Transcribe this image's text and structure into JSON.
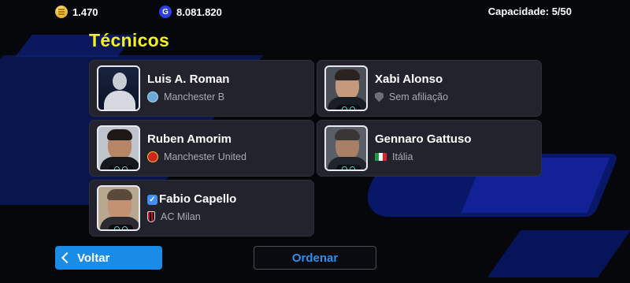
{
  "header": {
    "coins": "1.470",
    "gp": "8.081.820",
    "gp_icon_letter": "G",
    "capacity": "Capacidade: 5/50"
  },
  "page": {
    "title": "Técnicos"
  },
  "coaches": [
    {
      "name": "Luis A. Roman",
      "club": "Manchester B",
      "club_icon": "manchester-city-crest-icon",
      "portrait": "generic-silhouette"
    },
    {
      "name": "Xabi Alonso",
      "club": "Sem afiliação",
      "club_icon": "empty-shield-icon",
      "portrait": "photo"
    },
    {
      "name": "Ruben Amorim",
      "club": "Manchester United",
      "club_icon": "manchester-united-crest-icon",
      "portrait": "photo"
    },
    {
      "name": "Gennaro Gattuso",
      "club": "Itália",
      "club_icon": "italy-flag-icon",
      "portrait": "photo"
    },
    {
      "name": "Fabio Capello",
      "club": "AC Milan",
      "club_icon": "ac-milan-crest-icon",
      "portrait": "photo",
      "verified": true
    }
  ],
  "footer": {
    "back_label": "Voltar",
    "sort_label": "Ordenar"
  },
  "colors": {
    "title": "#f3f21c",
    "back_button": "#1a8ce8",
    "sort_text": "#2c8ff0",
    "card_bg": "#22232c"
  }
}
